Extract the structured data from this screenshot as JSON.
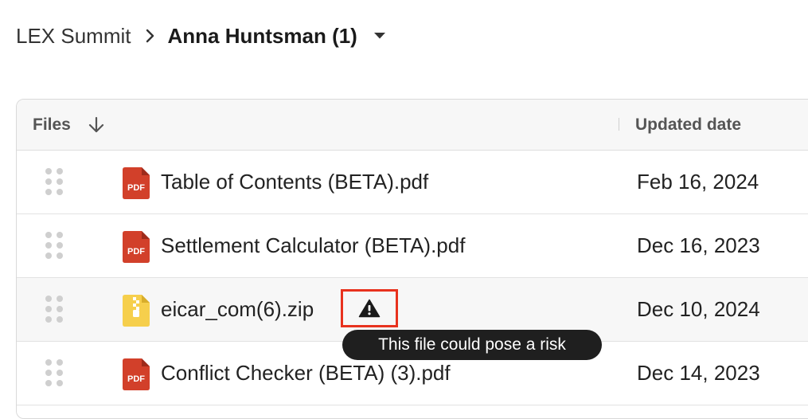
{
  "breadcrumb": {
    "parent": "LEX Summit",
    "current": "Anna Huntsman (1)",
    "icons": {
      "separator": "chevron-right-icon",
      "dropdown": "caret-down-icon"
    }
  },
  "table": {
    "columns": {
      "files": "Files",
      "updated": "Updated date"
    },
    "sort_icon": "arrow-down-icon",
    "rows": [
      {
        "name": "Table of Contents (BETA).pdf",
        "date": "Feb 16, 2024",
        "type": "pdf",
        "icon_label": "PDF"
      },
      {
        "name": "Settlement Calculator (BETA).pdf",
        "date": "Dec 16, 2023",
        "type": "pdf",
        "icon_label": "PDF"
      },
      {
        "name": "eicar_com(6).zip",
        "date": "Dec 10, 2024",
        "type": "zip",
        "warning": true
      },
      {
        "name": "Conflict Checker (BETA) (3).pdf",
        "date": "Dec 14, 2023",
        "type": "pdf",
        "icon_label": "PDF"
      }
    ]
  },
  "tooltip": {
    "text": "This file could pose a risk"
  },
  "colors": {
    "pdf": "#d2402a",
    "zip": "#f6cf4c",
    "warning_border": "#e8321e",
    "tooltip_bg": "#1f1f1f"
  }
}
